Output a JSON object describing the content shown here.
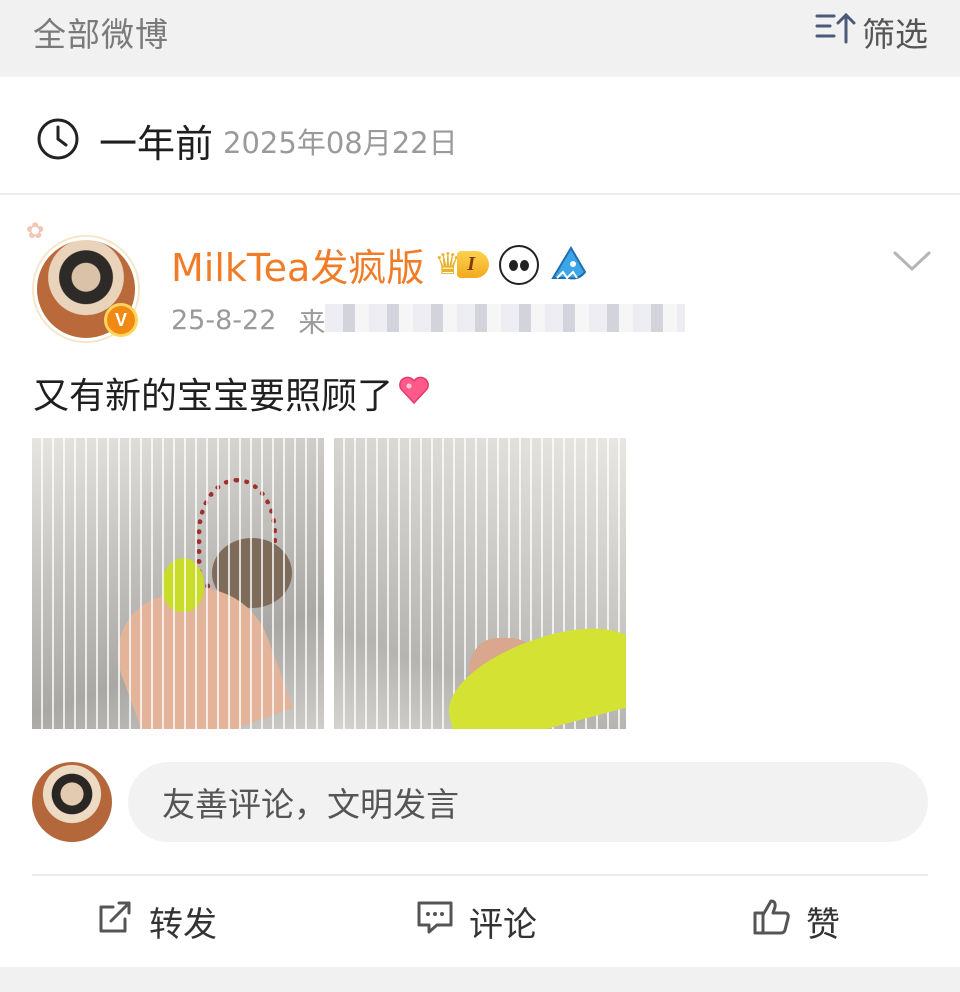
{
  "header": {
    "title": "全部微博",
    "filter_label": "筛选",
    "filter_icon": "sort-up-icon"
  },
  "timeline": {
    "relative": "一年前",
    "absolute": "2025年08月22日",
    "icon": "clock-icon"
  },
  "post": {
    "author": "MilkTea发疯版",
    "level_badge": "I",
    "verified_badge": "V",
    "date": "25-8-22",
    "source_prefix": "来",
    "text": "又有新的宝宝要照顾了",
    "emoji": "heart-emoji",
    "images": [
      {
        "name": "photo-bird-on-hand-cage"
      },
      {
        "name": "photo-bird-near-window"
      }
    ]
  },
  "comment_box": {
    "placeholder": "友善评论，文明发言"
  },
  "actions": {
    "repost": "转发",
    "comment": "评论",
    "like": "赞"
  },
  "colors": {
    "username": "#f07c28",
    "topbar_bg": "#f1f1f1",
    "muted_text": "#9a9a9a",
    "verified": "#f08a14"
  }
}
